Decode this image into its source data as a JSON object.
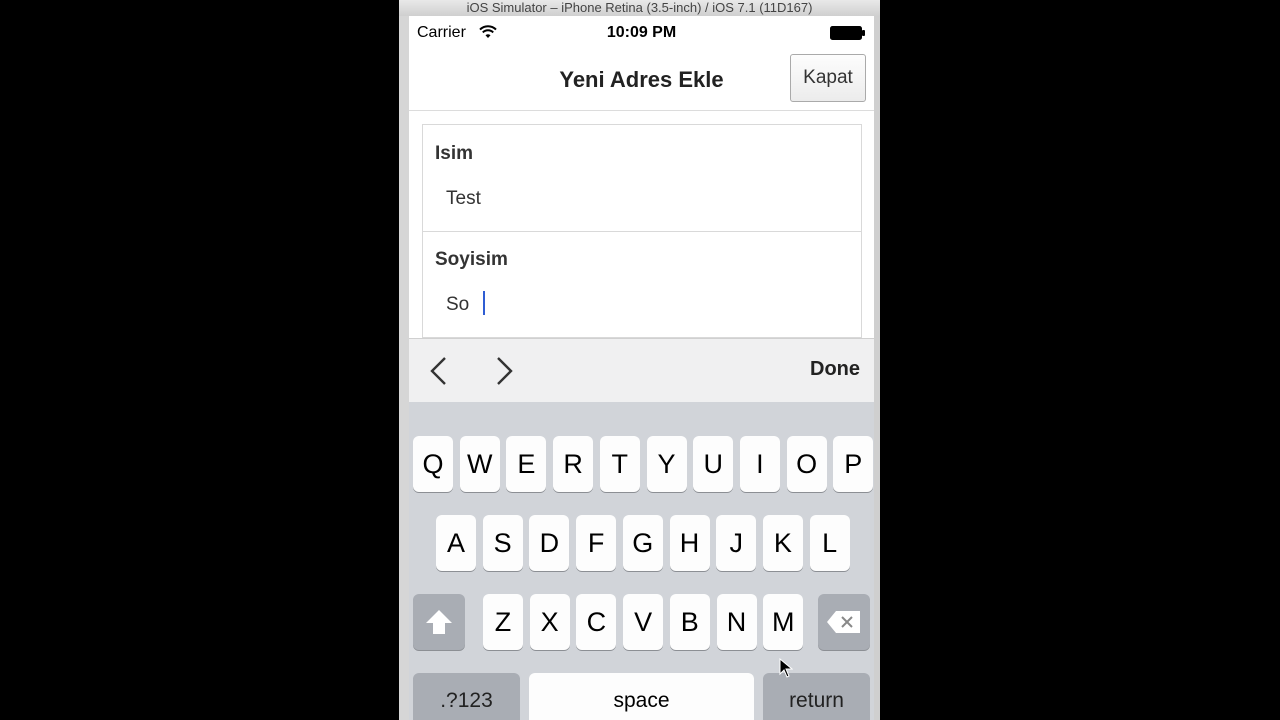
{
  "simulator": {
    "window_title": "iOS Simulator – iPhone Retina (3.5-inch) / iOS 7.1 (11D167)"
  },
  "status_bar": {
    "carrier": "Carrier",
    "time": "10:09 PM",
    "icons": [
      "wifi-icon",
      "battery-icon"
    ]
  },
  "nav": {
    "title": "Yeni Adres Ekle",
    "close_label": "Kapat"
  },
  "form": {
    "fields": [
      {
        "label": "Isim",
        "value": "Test"
      },
      {
        "label": "Soyisim",
        "value": "So"
      }
    ]
  },
  "accessory": {
    "prev_icon": "chevron-left-icon",
    "next_icon": "chevron-right-icon",
    "done_label": "Done"
  },
  "keyboard": {
    "row1": [
      "Q",
      "W",
      "E",
      "R",
      "T",
      "Y",
      "U",
      "I",
      "O",
      "P"
    ],
    "row2": [
      "A",
      "S",
      "D",
      "F",
      "G",
      "H",
      "J",
      "K",
      "L"
    ],
    "row3": [
      "Z",
      "X",
      "C",
      "V",
      "B",
      "N",
      "M"
    ],
    "shift_icon": "shift-icon",
    "delete_icon": "backspace-icon",
    "numbers_label": ".?123",
    "space_label": "space",
    "return_label": "return"
  },
  "colors": {
    "caret": "#2f5dd3",
    "keyboard_bg": "#d1d4d9"
  }
}
